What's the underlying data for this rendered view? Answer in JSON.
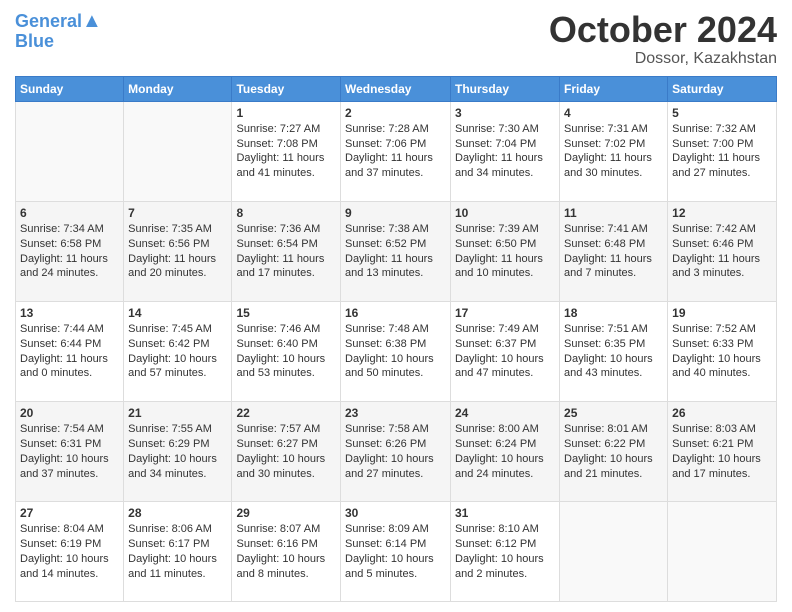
{
  "header": {
    "logo_line1": "General",
    "logo_line2": "Blue",
    "month_title": "October 2024",
    "location": "Dossor, Kazakhstan"
  },
  "weekdays": [
    "Sunday",
    "Monday",
    "Tuesday",
    "Wednesday",
    "Thursday",
    "Friday",
    "Saturday"
  ],
  "weeks": [
    [
      {
        "day": "",
        "info": ""
      },
      {
        "day": "",
        "info": ""
      },
      {
        "day": "1",
        "info": "Sunrise: 7:27 AM\nSunset: 7:08 PM\nDaylight: 11 hours and 41 minutes."
      },
      {
        "day": "2",
        "info": "Sunrise: 7:28 AM\nSunset: 7:06 PM\nDaylight: 11 hours and 37 minutes."
      },
      {
        "day": "3",
        "info": "Sunrise: 7:30 AM\nSunset: 7:04 PM\nDaylight: 11 hours and 34 minutes."
      },
      {
        "day": "4",
        "info": "Sunrise: 7:31 AM\nSunset: 7:02 PM\nDaylight: 11 hours and 30 minutes."
      },
      {
        "day": "5",
        "info": "Sunrise: 7:32 AM\nSunset: 7:00 PM\nDaylight: 11 hours and 27 minutes."
      }
    ],
    [
      {
        "day": "6",
        "info": "Sunrise: 7:34 AM\nSunset: 6:58 PM\nDaylight: 11 hours and 24 minutes."
      },
      {
        "day": "7",
        "info": "Sunrise: 7:35 AM\nSunset: 6:56 PM\nDaylight: 11 hours and 20 minutes."
      },
      {
        "day": "8",
        "info": "Sunrise: 7:36 AM\nSunset: 6:54 PM\nDaylight: 11 hours and 17 minutes."
      },
      {
        "day": "9",
        "info": "Sunrise: 7:38 AM\nSunset: 6:52 PM\nDaylight: 11 hours and 13 minutes."
      },
      {
        "day": "10",
        "info": "Sunrise: 7:39 AM\nSunset: 6:50 PM\nDaylight: 11 hours and 10 minutes."
      },
      {
        "day": "11",
        "info": "Sunrise: 7:41 AM\nSunset: 6:48 PM\nDaylight: 11 hours and 7 minutes."
      },
      {
        "day": "12",
        "info": "Sunrise: 7:42 AM\nSunset: 6:46 PM\nDaylight: 11 hours and 3 minutes."
      }
    ],
    [
      {
        "day": "13",
        "info": "Sunrise: 7:44 AM\nSunset: 6:44 PM\nDaylight: 11 hours and 0 minutes."
      },
      {
        "day": "14",
        "info": "Sunrise: 7:45 AM\nSunset: 6:42 PM\nDaylight: 10 hours and 57 minutes."
      },
      {
        "day": "15",
        "info": "Sunrise: 7:46 AM\nSunset: 6:40 PM\nDaylight: 10 hours and 53 minutes."
      },
      {
        "day": "16",
        "info": "Sunrise: 7:48 AM\nSunset: 6:38 PM\nDaylight: 10 hours and 50 minutes."
      },
      {
        "day": "17",
        "info": "Sunrise: 7:49 AM\nSunset: 6:37 PM\nDaylight: 10 hours and 47 minutes."
      },
      {
        "day": "18",
        "info": "Sunrise: 7:51 AM\nSunset: 6:35 PM\nDaylight: 10 hours and 43 minutes."
      },
      {
        "day": "19",
        "info": "Sunrise: 7:52 AM\nSunset: 6:33 PM\nDaylight: 10 hours and 40 minutes."
      }
    ],
    [
      {
        "day": "20",
        "info": "Sunrise: 7:54 AM\nSunset: 6:31 PM\nDaylight: 10 hours and 37 minutes."
      },
      {
        "day": "21",
        "info": "Sunrise: 7:55 AM\nSunset: 6:29 PM\nDaylight: 10 hours and 34 minutes."
      },
      {
        "day": "22",
        "info": "Sunrise: 7:57 AM\nSunset: 6:27 PM\nDaylight: 10 hours and 30 minutes."
      },
      {
        "day": "23",
        "info": "Sunrise: 7:58 AM\nSunset: 6:26 PM\nDaylight: 10 hours and 27 minutes."
      },
      {
        "day": "24",
        "info": "Sunrise: 8:00 AM\nSunset: 6:24 PM\nDaylight: 10 hours and 24 minutes."
      },
      {
        "day": "25",
        "info": "Sunrise: 8:01 AM\nSunset: 6:22 PM\nDaylight: 10 hours and 21 minutes."
      },
      {
        "day": "26",
        "info": "Sunrise: 8:03 AM\nSunset: 6:21 PM\nDaylight: 10 hours and 17 minutes."
      }
    ],
    [
      {
        "day": "27",
        "info": "Sunrise: 8:04 AM\nSunset: 6:19 PM\nDaylight: 10 hours and 14 minutes."
      },
      {
        "day": "28",
        "info": "Sunrise: 8:06 AM\nSunset: 6:17 PM\nDaylight: 10 hours and 11 minutes."
      },
      {
        "day": "29",
        "info": "Sunrise: 8:07 AM\nSunset: 6:16 PM\nDaylight: 10 hours and 8 minutes."
      },
      {
        "day": "30",
        "info": "Sunrise: 8:09 AM\nSunset: 6:14 PM\nDaylight: 10 hours and 5 minutes."
      },
      {
        "day": "31",
        "info": "Sunrise: 8:10 AM\nSunset: 6:12 PM\nDaylight: 10 hours and 2 minutes."
      },
      {
        "day": "",
        "info": ""
      },
      {
        "day": "",
        "info": ""
      }
    ]
  ]
}
